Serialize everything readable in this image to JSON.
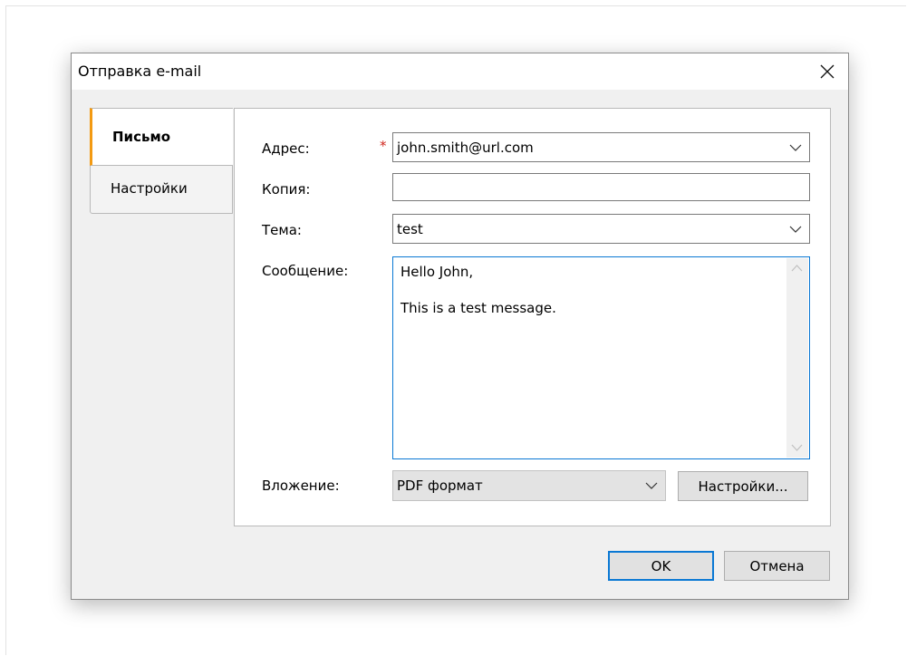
{
  "dialog": {
    "title": "Отправка e-mail"
  },
  "tabs": [
    {
      "label": "Письмо",
      "active": true
    },
    {
      "label": "Настройки",
      "active": false
    }
  ],
  "form": {
    "address_label": "Адрес:",
    "address_value": "john.smith@url.com",
    "required_marker": "*",
    "cc_label": "Копия:",
    "cc_value": "",
    "subject_label": "Тема:",
    "subject_value": "test",
    "message_label": "Сообщение:",
    "message_lines": [
      "Hello John,",
      "This is a test message."
    ],
    "attachment_label": "Вложение:",
    "attachment_value": "PDF формат",
    "attachment_settings_label": "Настройки..."
  },
  "footer": {
    "ok_label": "OK",
    "cancel_label": "Отмена"
  },
  "icons": {
    "close": "close-icon",
    "dropdown": "chevron-down-icon",
    "scroll_up": "chevron-up-icon",
    "scroll_down": "chevron-down-icon"
  },
  "colors": {
    "accent": "#0a78d4",
    "active_tab_marker": "#f39a12",
    "required": "#d0261d",
    "dialog_background": "#f0f0f0"
  }
}
